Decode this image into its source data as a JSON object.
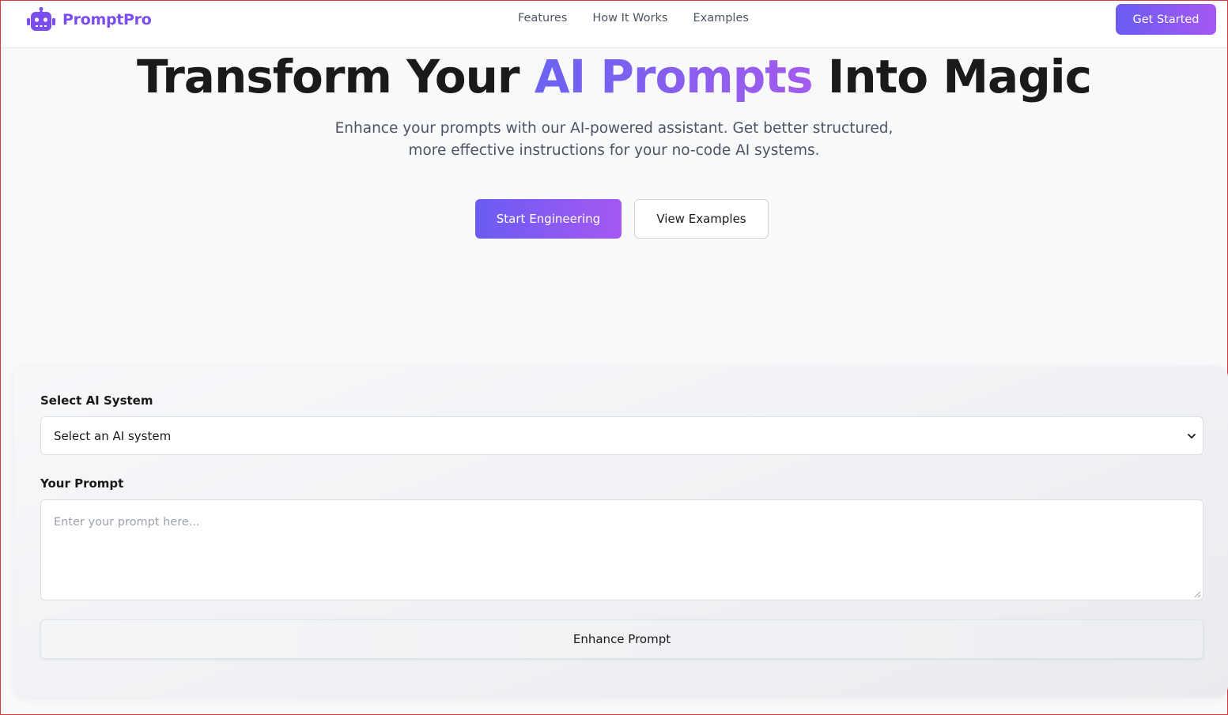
{
  "brand": {
    "name": "PromptPro",
    "icon": "robot-icon",
    "color": "#7c4dee"
  },
  "nav": {
    "links": [
      "Features",
      "How It Works",
      "Examples"
    ],
    "cta_label": "Get Started"
  },
  "hero": {
    "title_before": "Transform Your ",
    "title_accent": "AI Prompts",
    "title_after": " Into Magic",
    "subtitle_line1": "Enhance your prompts with our AI-powered assistant. Get better structured,",
    "subtitle_line2": "more effective instructions for your no-code AI systems.",
    "primary_button": "Start Engineering",
    "secondary_button": "View Examples"
  },
  "form": {
    "system_label": "Select AI System",
    "system_selected": "Select an AI system",
    "prompt_label": "Your Prompt",
    "prompt_placeholder": "Enter your prompt here...",
    "prompt_value": "",
    "submit_label": "Enhance Prompt"
  },
  "colors": {
    "accent_start": "#6a5cf2",
    "accent_end": "#a558f2",
    "text_primary": "#1a1a1a",
    "text_secondary": "#4b5563",
    "page_background": "#f8f9fb"
  }
}
